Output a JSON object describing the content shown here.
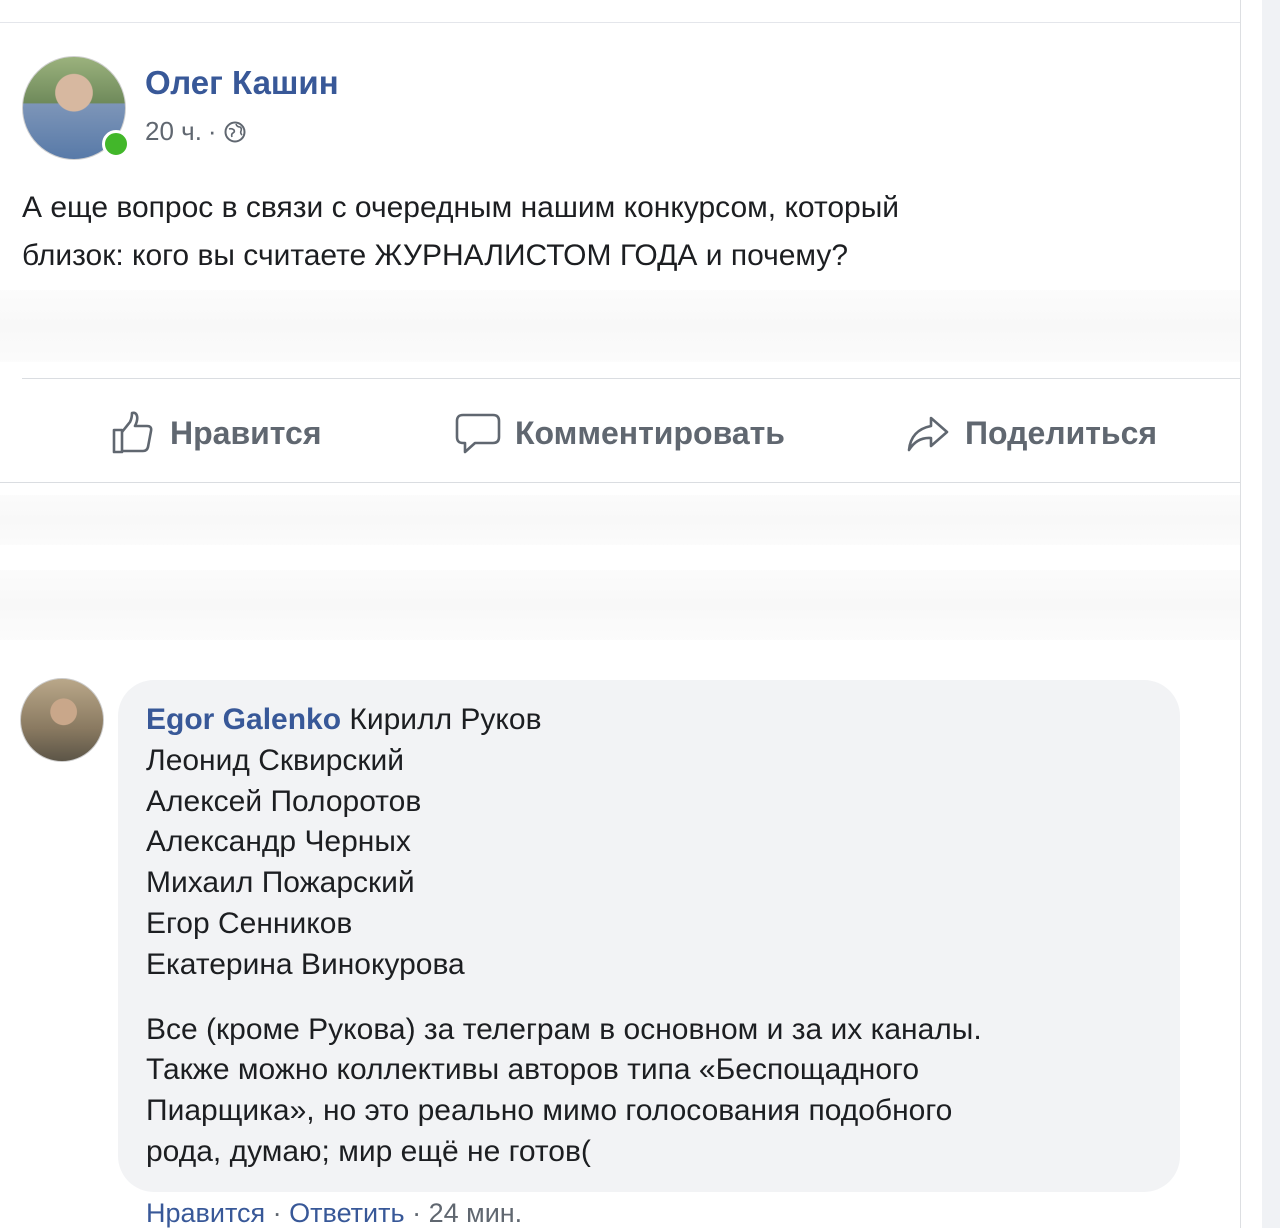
{
  "post": {
    "author": "Олег Кашин",
    "time": "20 ч.",
    "separator": "·",
    "privacy_icon": "globe-icon",
    "text_line1": "А еще вопрос в связи с очередным нашим конкурсом, который",
    "text_line2": "близок: кого вы считаете ЖУРНАЛИСТОМ ГОДА и почему?"
  },
  "actions": {
    "like": "Нравится",
    "comment": "Комментировать",
    "share": "Поделиться"
  },
  "comment": {
    "author": "Egor Galenko",
    "names": [
      "Кирилл Руков",
      "Леонид Сквирский",
      "Алексей Полоротов",
      "Александр Черных",
      "Михаил Пожарский",
      "Егор Сенников",
      "Екатерина Винокурова"
    ],
    "paragraph_lines": [
      "Все (кроме Рукова) за телеграм в основном и за их каналы.",
      "Также можно коллективы авторов типа «Беспощадного",
      "Пиарщика», но это реально мимо голосования подобного",
      "рода, думаю; мир ещё не готов("
    ],
    "like_label": "Нравится",
    "reply_label": "Ответить",
    "time": "24 мин."
  },
  "colors": {
    "link": "#385898",
    "secondary": "#606770",
    "online": "#42b72a",
    "bubble": "#f2f3f5"
  }
}
